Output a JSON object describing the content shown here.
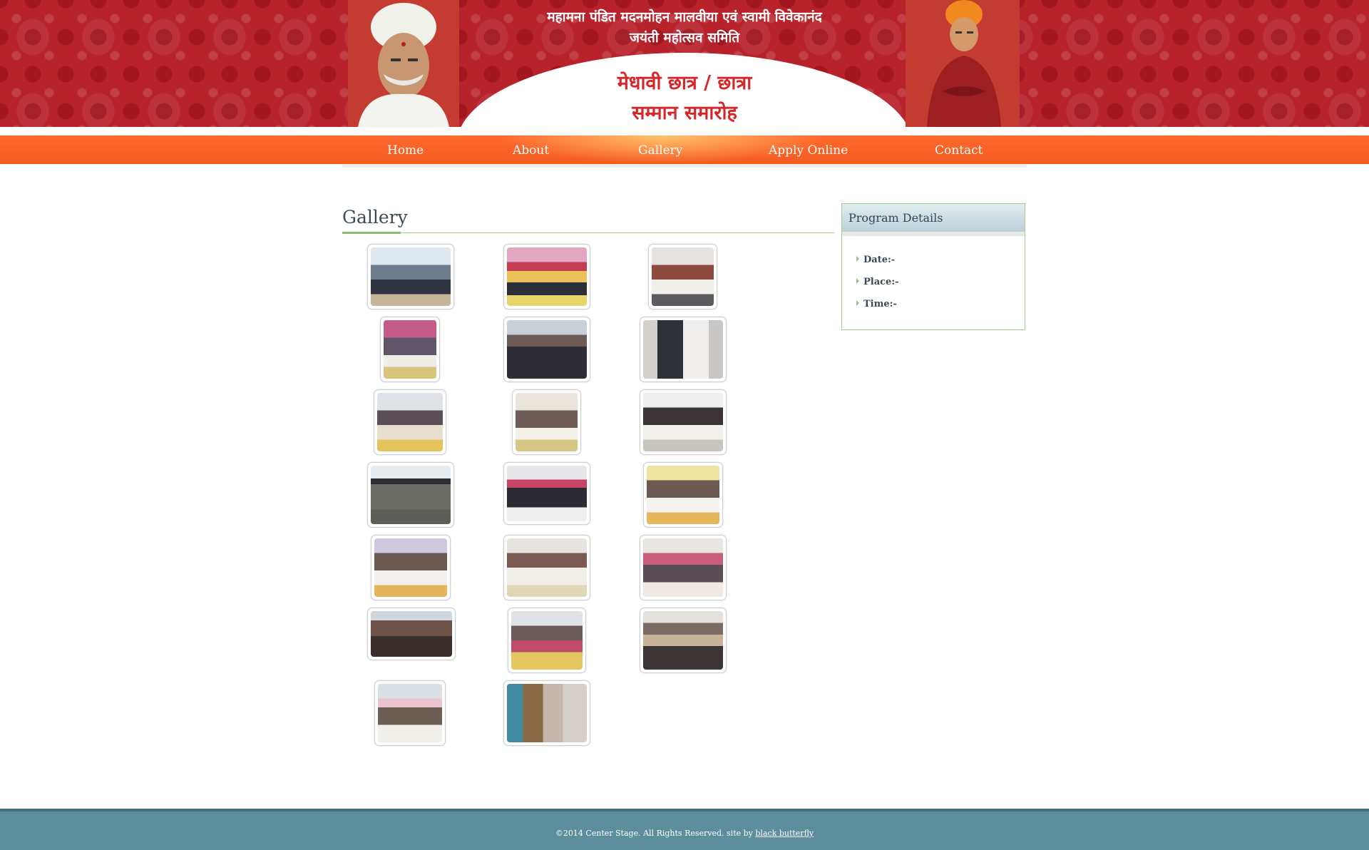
{
  "header": {
    "committee_line1": "महामना पंडित मदनमोहन मालवीया एवं स्वामी विवेकानंद",
    "committee_line2": "जयंती महोत्सव समिति",
    "event_line1": "मेधावी छात्र / छात्रा",
    "event_line2": "सम्मान समारोह"
  },
  "nav": {
    "items": [
      {
        "label": "Home"
      },
      {
        "label": "About"
      },
      {
        "label": "Gallery"
      },
      {
        "label": "Apply Online"
      },
      {
        "label": "Contact"
      }
    ]
  },
  "main": {
    "section_title": "Gallery"
  },
  "sidebar": {
    "title": "Program Details",
    "details": [
      {
        "label": "Date:-"
      },
      {
        "label": "Place:-"
      },
      {
        "label": "Time:-"
      }
    ]
  },
  "footer": {
    "copyright": "©2014 Center Stage. All Rights Reserved. site by ",
    "credit_link": "black butterfly"
  },
  "colors": {
    "header_red": "#b8222b",
    "nav_orange": "#f35b20",
    "title_red": "#d7262a",
    "footer_teal": "#5c8e9e",
    "accent_green": "#a9cf8f"
  }
}
